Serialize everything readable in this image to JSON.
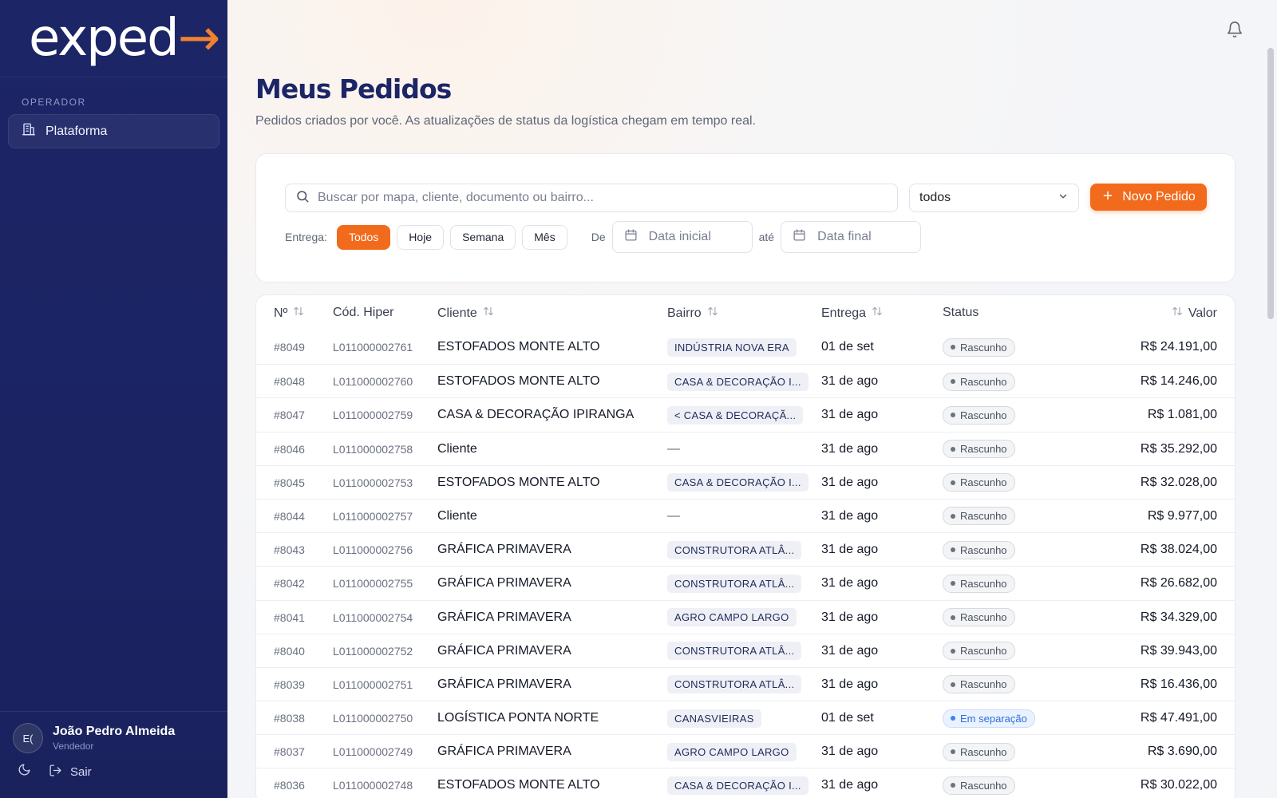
{
  "brand": {
    "logo_main": "exped",
    "logo_accent": "→"
  },
  "sidebar": {
    "section_title": "OPERADOR",
    "items": [
      {
        "label": "Plataforma",
        "icon": "building-icon"
      }
    ],
    "user": {
      "initials": "E(",
      "name": "João Pedro Almeida",
      "role": "Vendedor"
    },
    "logout_label": "Sair"
  },
  "header": {
    "title": "Meus Pedidos",
    "subtitle": "Pedidos criados por você. As atualizações de status da logística chegam em tempo real."
  },
  "filters": {
    "search_placeholder": "Buscar por mapa, cliente, documento ou bairro...",
    "status_select": "todos",
    "new_order_label": "Novo Pedido",
    "entrega_label": "Entrega:",
    "pills": [
      "Todos",
      "Hoje",
      "Semana",
      "Mês"
    ],
    "active_pill": "Todos",
    "de_label": "De",
    "date_start_placeholder": "Data inicial",
    "ate_label": "até",
    "date_end_placeholder": "Data final"
  },
  "table": {
    "columns": {
      "num": "Nº",
      "hiper": "Cód. Hiper",
      "cliente": "Cliente",
      "bairro": "Bairro",
      "entrega": "Entrega",
      "status": "Status",
      "valor": "Valor"
    },
    "rows": [
      {
        "num": "#8049",
        "hiper": "L011000002761",
        "cliente": "ESTOFADOS MONTE ALTO",
        "bairro": "INDÚSTRIA NOVA ERA",
        "entrega": "01 de set",
        "status": "Rascunho",
        "valor": "R$ 24.191,00"
      },
      {
        "num": "#8048",
        "hiper": "L011000002760",
        "cliente": "ESTOFADOS MONTE ALTO",
        "bairro": "CASA & DECORAÇÃO I...",
        "entrega": "31 de ago",
        "status": "Rascunho",
        "valor": "R$ 14.246,00"
      },
      {
        "num": "#8047",
        "hiper": "L011000002759",
        "cliente": "CASA & DECORAÇÃO IPIRANGA",
        "bairro": "< CASA & DECORAÇÃ...",
        "entrega": "31 de ago",
        "status": "Rascunho",
        "valor": "R$ 1.081,00"
      },
      {
        "num": "#8046",
        "hiper": "L011000002758",
        "cliente": "Cliente",
        "bairro": "",
        "entrega": "31 de ago",
        "status": "Rascunho",
        "valor": "R$ 35.292,00"
      },
      {
        "num": "#8045",
        "hiper": "L011000002753",
        "cliente": "ESTOFADOS MONTE ALTO",
        "bairro": "CASA & DECORAÇÃO I...",
        "entrega": "31 de ago",
        "status": "Rascunho",
        "valor": "R$ 32.028,00"
      },
      {
        "num": "#8044",
        "hiper": "L011000002757",
        "cliente": "Cliente",
        "bairro": "",
        "entrega": "31 de ago",
        "status": "Rascunho",
        "valor": "R$ 9.977,00"
      },
      {
        "num": "#8043",
        "hiper": "L011000002756",
        "cliente": "GRÁFICA PRIMAVERA",
        "bairro": "CONSTRUTORA ATLÂ...",
        "entrega": "31 de ago",
        "status": "Rascunho",
        "valor": "R$ 38.024,00"
      },
      {
        "num": "#8042",
        "hiper": "L011000002755",
        "cliente": "GRÁFICA PRIMAVERA",
        "bairro": "CONSTRUTORA ATLÂ...",
        "entrega": "31 de ago",
        "status": "Rascunho",
        "valor": "R$ 26.682,00"
      },
      {
        "num": "#8041",
        "hiper": "L011000002754",
        "cliente": "GRÁFICA PRIMAVERA",
        "bairro": "AGRO CAMPO LARGO",
        "entrega": "31 de ago",
        "status": "Rascunho",
        "valor": "R$ 34.329,00"
      },
      {
        "num": "#8040",
        "hiper": "L011000002752",
        "cliente": "GRÁFICA PRIMAVERA",
        "bairro": "CONSTRUTORA ATLÂ...",
        "entrega": "31 de ago",
        "status": "Rascunho",
        "valor": "R$ 39.943,00"
      },
      {
        "num": "#8039",
        "hiper": "L011000002751",
        "cliente": "GRÁFICA PRIMAVERA",
        "bairro": "CONSTRUTORA ATLÂ...",
        "entrega": "31 de ago",
        "status": "Rascunho",
        "valor": "R$ 16.436,00"
      },
      {
        "num": "#8038",
        "hiper": "L011000002750",
        "cliente": "LOGÍSTICA PONTA NORTE",
        "bairro": "CANASVIEIRAS",
        "entrega": "01 de set",
        "status": "Em separação",
        "valor": "R$ 47.491,00"
      },
      {
        "num": "#8037",
        "hiper": "L011000002749",
        "cliente": "GRÁFICA PRIMAVERA",
        "bairro": "AGRO CAMPO LARGO",
        "entrega": "31 de ago",
        "status": "Rascunho",
        "valor": "R$ 3.690,00"
      },
      {
        "num": "#8036",
        "hiper": "L011000002748",
        "cliente": "ESTOFADOS MONTE ALTO",
        "bairro": "CASA & DECORAÇÃO I...",
        "entrega": "31 de ago",
        "status": "Rascunho",
        "valor": "R$ 30.022,00"
      }
    ]
  },
  "colors": {
    "sidebar_bg": "#1c2566",
    "accent": "#f26a1b",
    "title": "#1c2566",
    "status_blue": "#2f6fd8"
  }
}
